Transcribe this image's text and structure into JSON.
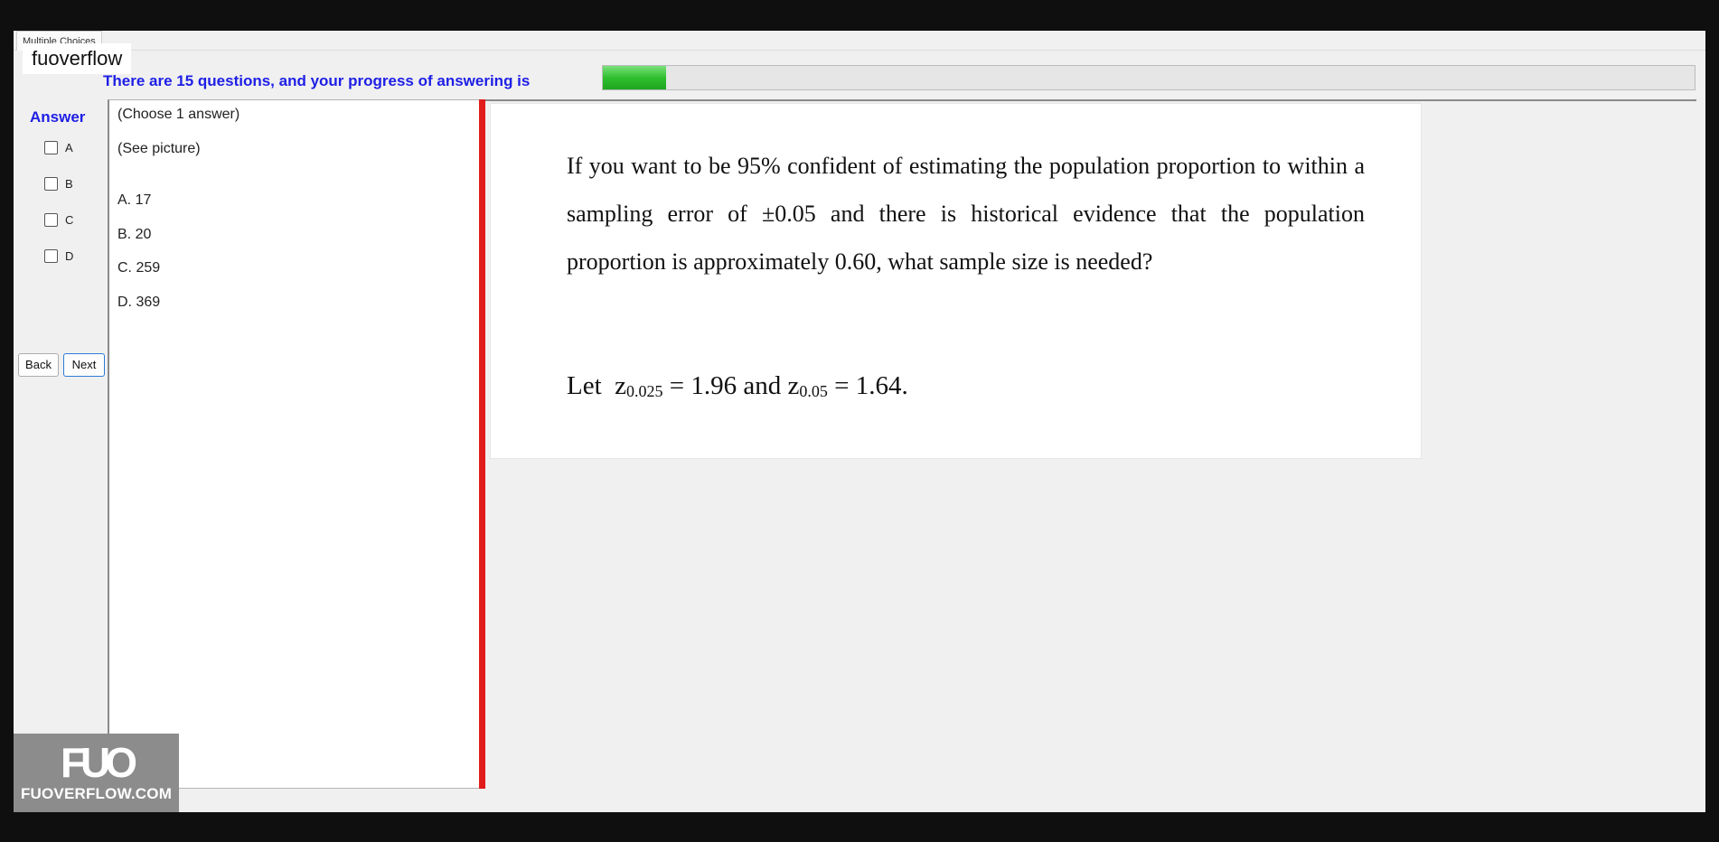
{
  "window": {
    "tab_title": "Multiple Choices",
    "watermark": "fuoverflow"
  },
  "progress": {
    "label": "There are 15 questions, and your progress of answering is",
    "total_questions": 15,
    "fraction": 0.058
  },
  "answer": {
    "heading": "Answer",
    "options": [
      {
        "label": "A",
        "checked": false
      },
      {
        "label": "B",
        "checked": false
      },
      {
        "label": "C",
        "checked": false
      },
      {
        "label": "D",
        "checked": false
      }
    ]
  },
  "nav": {
    "back_label": "Back",
    "next_label": "Next"
  },
  "question_list": {
    "instruction": "(Choose 1 answer)",
    "see_picture": "(See picture)",
    "choices": [
      "A.  17",
      "B.  20",
      "C.  259",
      "D.  369"
    ]
  },
  "question": {
    "text": "If you want to be 95% confident of estimating the population proportion to within a sampling error of ±0.05 and there is historical evidence that the population proportion is approximately 0.60, what sample size is needed?",
    "hint_let": "Let",
    "z1_base": "z",
    "z1_sub": "0.025",
    "z1_value": "= 1.96 and",
    "z2_base": "z",
    "z2_sub": "0.05",
    "z2_value": "= 1.64."
  },
  "logo": {
    "mark": "FUO",
    "text": "FUOVERFLOW.COM"
  },
  "colors": {
    "accent_blue": "#1e1ee6",
    "splitter_red": "#e21b1b",
    "progress_green": "#2fbf2f"
  }
}
